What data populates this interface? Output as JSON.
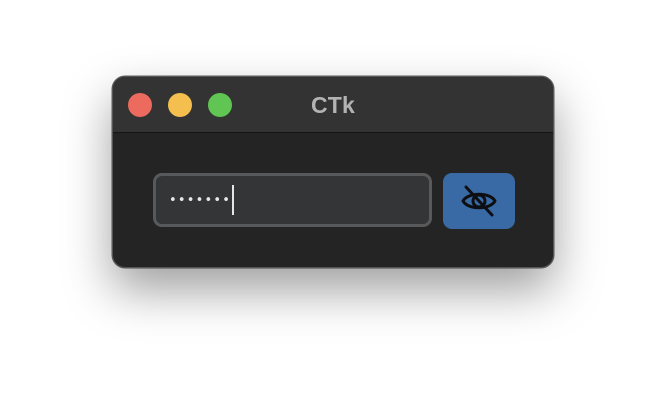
{
  "window": {
    "title": "CTk",
    "buttons": {
      "close_color": "#ed6a5e",
      "minimize_color": "#f4bf4f",
      "zoom_color": "#61c554"
    }
  },
  "password_field": {
    "value": "•••••••",
    "caret_visible": true
  },
  "toggle_visibility_button": {
    "icon": "eye-slash-icon",
    "color": "#3a6aa6"
  }
}
